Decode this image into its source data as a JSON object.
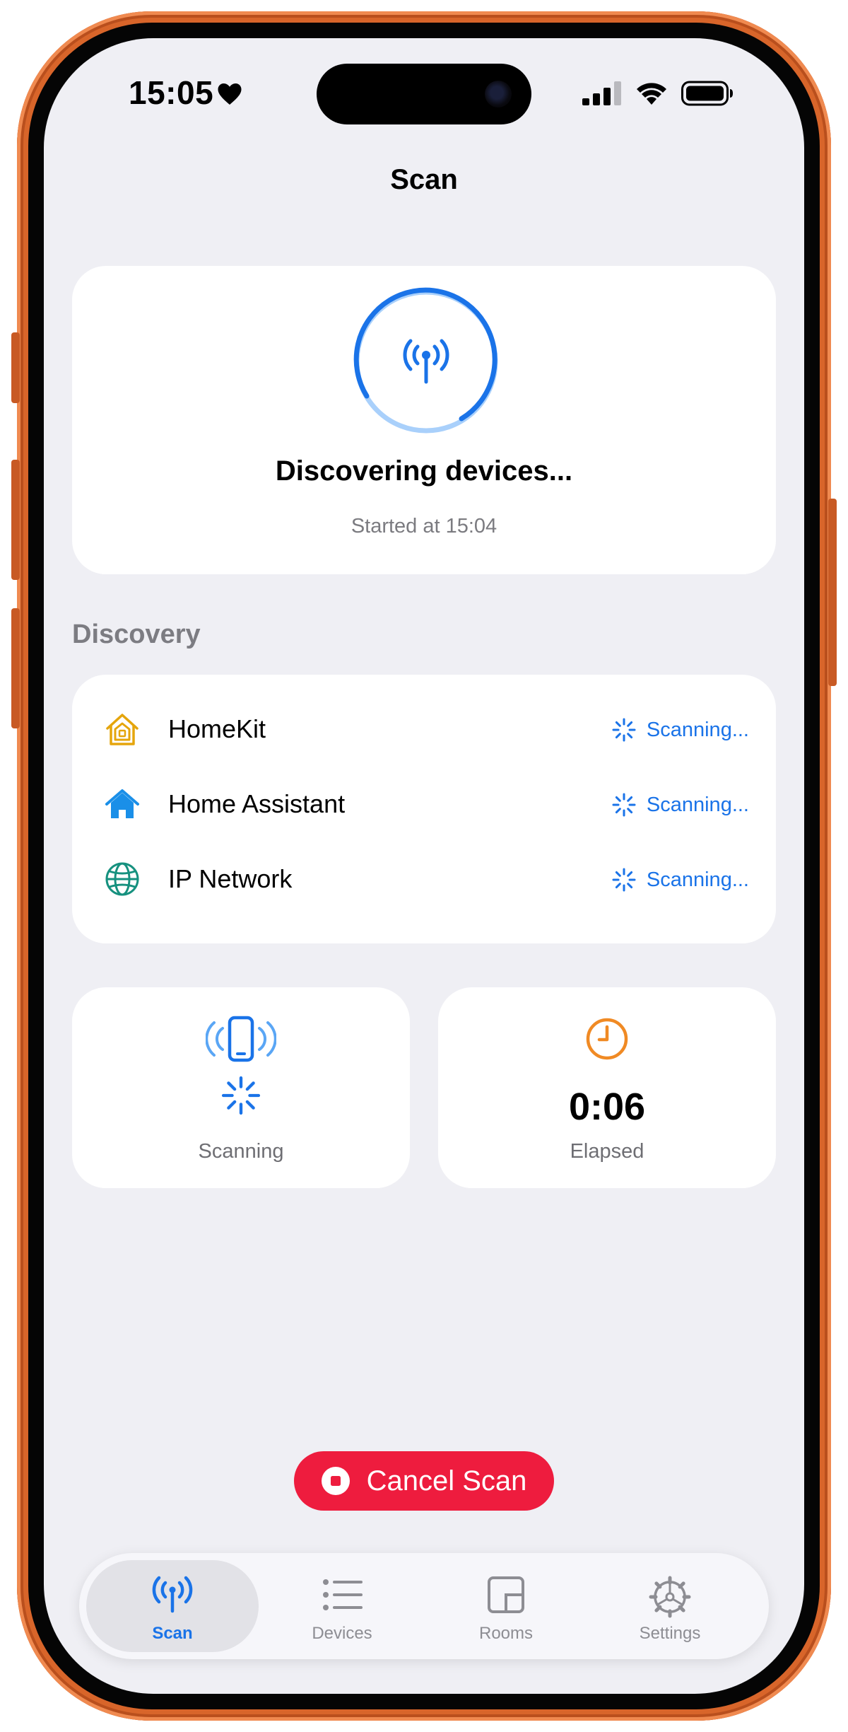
{
  "status_bar": {
    "time": "15:05"
  },
  "nav": {
    "title": "Scan"
  },
  "hero": {
    "title": "Discovering devices...",
    "subtitle": "Started at 15:04",
    "icon": "antenna-radiowaves-icon"
  },
  "discovery": {
    "section_title": "Discovery",
    "items": [
      {
        "label": "HomeKit",
        "status": "Scanning...",
        "icon": "homekit-house-icon"
      },
      {
        "label": "Home Assistant",
        "status": "Scanning...",
        "icon": "house-fill-icon"
      },
      {
        "label": "IP Network",
        "status": "Scanning...",
        "icon": "globe-icon"
      }
    ]
  },
  "tiles": {
    "scanning": {
      "label": "Scanning",
      "icon": "iphone-radiowaves-icon"
    },
    "elapsed": {
      "value": "0:06",
      "label": "Elapsed",
      "icon": "clock-icon"
    }
  },
  "cancel_button": {
    "label": "Cancel Scan"
  },
  "tabbar": {
    "tabs": [
      {
        "label": "Scan",
        "icon": "antenna-icon",
        "active": true
      },
      {
        "label": "Devices",
        "icon": "list-icon",
        "active": false
      },
      {
        "label": "Rooms",
        "icon": "rooms-icon",
        "active": false
      },
      {
        "label": "Settings",
        "icon": "gear-icon",
        "active": false
      }
    ]
  },
  "colors": {
    "accent": "#1a73e8",
    "danger": "#ee1c3e",
    "background": "#efeff4",
    "phone_frame": "#d8652a"
  }
}
